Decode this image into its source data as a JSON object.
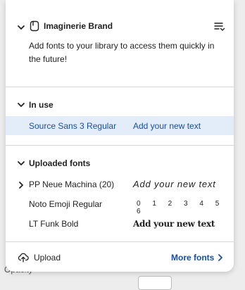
{
  "brand": {
    "name": "Imaginerie Brand",
    "description": "Add fonts to your library to access them quickly in the future!"
  },
  "in_use": {
    "title": "In use",
    "items": [
      {
        "name": "Source Sans 3 Regular",
        "sample": "Add your new text"
      }
    ]
  },
  "uploaded": {
    "title": "Uploaded fonts",
    "items": [
      {
        "name": "PP Neue Machina (20)",
        "sample": "Add your new text"
      },
      {
        "name": "Noto Emoji Regular",
        "sample": "0 1 2 3 4 5 6"
      },
      {
        "name": "LT Funk Bold",
        "sample": "Add your new text"
      }
    ]
  },
  "footer": {
    "upload_label": "Upload",
    "more_fonts_label": "More fonts"
  },
  "backdrop": {
    "label": "Opacity"
  },
  "colors": {
    "accent": "#1a4fa0",
    "selected_row": "#e3edf9"
  }
}
